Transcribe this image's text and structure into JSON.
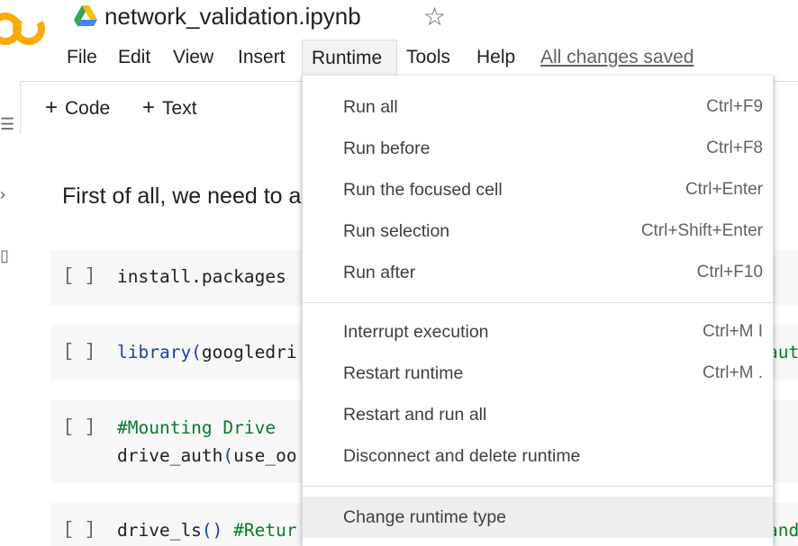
{
  "app": {
    "title": "network_validation.ipynb",
    "logo_text": "CO",
    "saved_status": "All changes saved"
  },
  "menubar": {
    "items": [
      {
        "label": "File"
      },
      {
        "label": "Edit"
      },
      {
        "label": "View"
      },
      {
        "label": "Insert"
      },
      {
        "label": "Runtime",
        "active": true
      },
      {
        "label": "Tools"
      },
      {
        "label": "Help"
      }
    ]
  },
  "toolbar": {
    "add_code": "Code",
    "add_text": "Text"
  },
  "notebook": {
    "text_cell": "First of all, we need to a",
    "cells": [
      {
        "bracket": "[ ]",
        "line1": "install.packages"
      },
      {
        "bracket": "[ ]",
        "line1_fn": "library(",
        "line1_rest": "googledri",
        "tail": "aut"
      },
      {
        "bracket": "[ ]",
        "line1": "#Mounting Drive",
        "line2_a": "drive_auth",
        "line2_b": "(",
        "line2_c": "use_oo"
      },
      {
        "bracket": "[ ]",
        "line1_a": "drive_ls",
        "line1_b": "()",
        "line1_c": " #Retur",
        "tail": "and"
      }
    ]
  },
  "runtime_menu": {
    "items": [
      {
        "label": "Run all",
        "shortcut": "Ctrl+F9"
      },
      {
        "label": "Run before",
        "shortcut": "Ctrl+F8"
      },
      {
        "label": "Run the focused cell",
        "shortcut": "Ctrl+Enter"
      },
      {
        "label": "Run selection",
        "shortcut": "Ctrl+Shift+Enter"
      },
      {
        "label": "Run after",
        "shortcut": "Ctrl+F10"
      },
      {
        "label": "Interrupt execution",
        "shortcut": "Ctrl+M I"
      },
      {
        "label": "Restart runtime",
        "shortcut": "Ctrl+M ."
      },
      {
        "label": "Restart and run all",
        "shortcut": ""
      },
      {
        "label": "Disconnect and delete runtime",
        "shortcut": ""
      },
      {
        "label": "Change runtime type",
        "shortcut": "",
        "highlighted": true
      }
    ]
  },
  "colors": {
    "logo": "#f9ab00",
    "accent_blue": "#1a3faa",
    "comment_green": "#0b7a2c",
    "menu_highlight": "#eeeeee"
  },
  "icons": {
    "star": "star-icon",
    "drive": "google-drive-icon",
    "plus": "plus-icon",
    "rail": [
      "menu-icon",
      "search-icon",
      "code-icon"
    ]
  }
}
